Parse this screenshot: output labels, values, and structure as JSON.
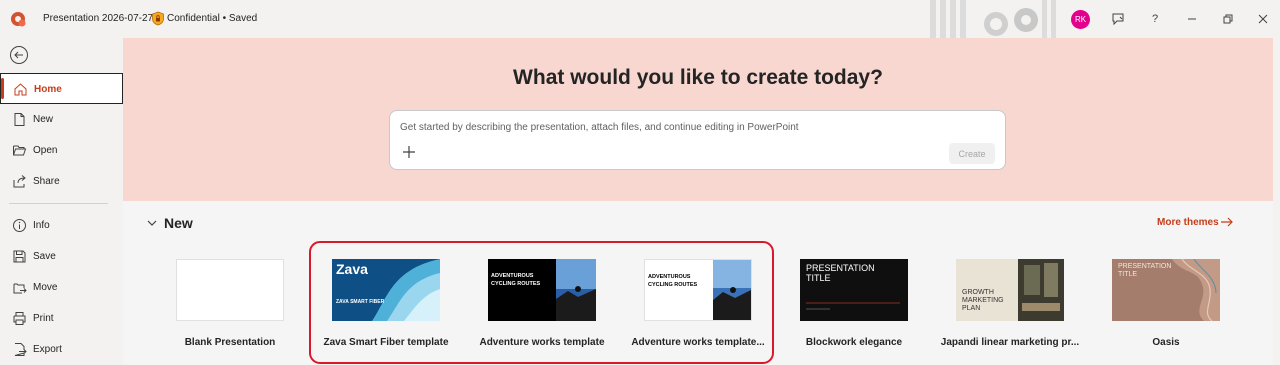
{
  "titlebar": {
    "doc_title": "Presentation 2026-07-27",
    "sensitivity": "Confidential",
    "save_status": "Saved",
    "avatar_initials": "RK",
    "help_label": "?"
  },
  "sidebar": {
    "items": [
      {
        "label": "Home",
        "icon": "home-icon"
      },
      {
        "label": "New",
        "icon": "new-document-icon"
      },
      {
        "label": "Open",
        "icon": "folder-open-icon"
      },
      {
        "label": "Share",
        "icon": "share-icon"
      },
      {
        "label": "Info",
        "icon": "info-icon"
      },
      {
        "label": "Save",
        "icon": "save-icon"
      },
      {
        "label": "Move",
        "icon": "move-icon"
      },
      {
        "label": "Print",
        "icon": "print-icon"
      },
      {
        "label": "Export",
        "icon": "export-icon"
      }
    ]
  },
  "hero": {
    "title": "What would you like to create today?",
    "prompt_placeholder": "Get started by describing the presentation, attach files, and continue editing in PowerPoint",
    "create_label": "Create"
  },
  "new_section": {
    "heading": "New",
    "more_themes": "More themes",
    "templates": [
      {
        "name": "Blank Presentation"
      },
      {
        "name": "Zava Smart Fiber template",
        "thumb_logo": "Zava",
        "thumb_text": "ZAVA SMART FIBER"
      },
      {
        "name": "Adventure works template",
        "thumb_text": "ADVENTUROUS CYCLING ROUTES"
      },
      {
        "name": "Adventure works template...",
        "thumb_text": "ADVENTUROUS CYCLING ROUTES"
      },
      {
        "name": "Blockwork elegance",
        "thumb_text": "PRESENTATION TITLE"
      },
      {
        "name": "Japandi linear marketing pr...",
        "thumb_text": "GROWTH MARKETING PLAN"
      },
      {
        "name": "Oasis",
        "thumb_text": "PRESENTATION TITLE"
      }
    ]
  },
  "colors": {
    "accent": "#c43e1c",
    "hero_bg": "#f7d7d0",
    "highlight": "#d9182b",
    "avatar": "#e3008c"
  }
}
